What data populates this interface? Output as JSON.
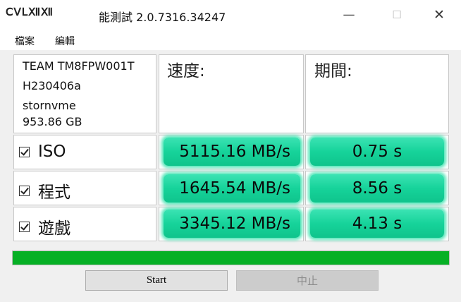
{
  "window": {
    "logo_text": "ⅭⅤⅬⅫⅫ",
    "title": "能測試 2.0.7316.34247",
    "minimize_glyph": "—",
    "maximize_glyph": "☐",
    "close_glyph": "✕"
  },
  "menu": [
    "檔案",
    "編輯"
  ],
  "drive": {
    "model": "TEAM TM8FPW001T",
    "firmware": "H230406a",
    "driver": "stornvme",
    "capacity": "953.86 GB"
  },
  "headers": {
    "speed": "速度:",
    "time": "期間:"
  },
  "tests": [
    {
      "checked": true,
      "label": "ISO",
      "speed": "5115.16 MB/s",
      "time": "0.75 s"
    },
    {
      "checked": true,
      "label": "程式",
      "speed": "1645.54 MB/s",
      "time": "8.56 s"
    },
    {
      "checked": true,
      "label": "遊戲",
      "speed": "3345.12 MB/s",
      "time": "4.13 s"
    }
  ],
  "progress": {
    "percent": 100,
    "color": "#06b025"
  },
  "buttons": {
    "start": "Start",
    "stop": "中止"
  },
  "colors": {
    "result_green": "#16d39a",
    "progress_green": "#06b025"
  }
}
